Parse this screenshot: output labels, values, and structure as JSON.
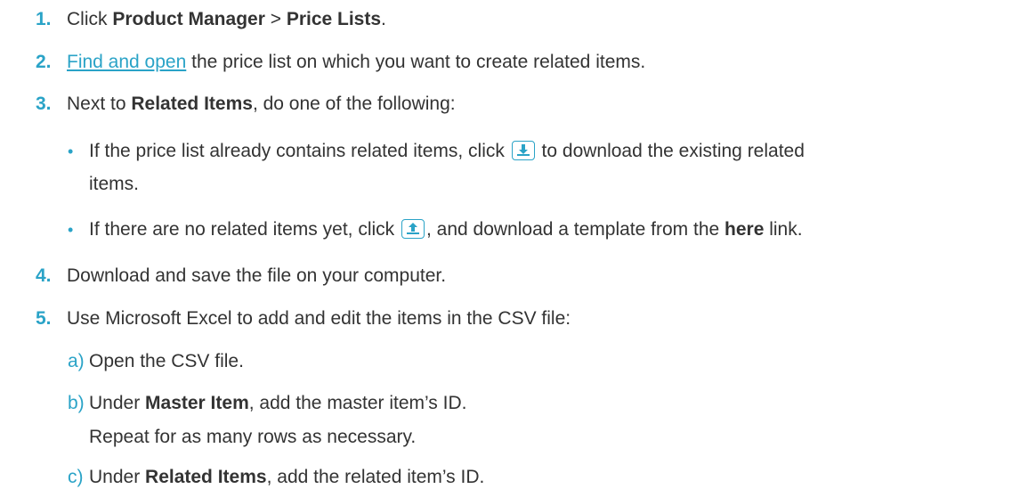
{
  "steps": {
    "s1": {
      "num": "1.",
      "a": "Click ",
      "b1": "Product Manager",
      "c": " > ",
      "b2": "Price Lists",
      "d": "."
    },
    "s2": {
      "num": "2.",
      "link": "Find and open",
      "rest": " the price list on which you want to create related items."
    },
    "s3": {
      "num": "3.",
      "a": "Next to ",
      "b": "Related Items",
      "c": ", do one of the following:"
    },
    "s4": {
      "num": "4.",
      "text": "Download and save the file on your computer."
    },
    "s5": {
      "num": "5.",
      "text": "Use Microsoft Excel to add and edit the items in the CSV file:"
    }
  },
  "bullets": {
    "b1": {
      "a": "If the price list already contains related items, click ",
      "c": " to download the existing related",
      "d": "items."
    },
    "b2": {
      "a": "If there are no related items yet, click ",
      "c": ", and download a template from the ",
      "bold": "here",
      "d": " link."
    }
  },
  "substeps": {
    "a": {
      "label": "a)",
      "text": "Open the CSV file."
    },
    "b": {
      "label": "b)",
      "pre": "Under ",
      "bold": "Master Item",
      "post": ", add the master item’s ID.",
      "note": "Repeat for as many rows as necessary."
    },
    "c": {
      "label": "c)",
      "pre": "Under ",
      "bold": "Related Items",
      "post": ", add the related item’s ID."
    }
  },
  "icons": {
    "download": "download-icon",
    "upload": "upload-icon"
  },
  "colors": {
    "accent": "#2aa3c7",
    "text": "#333333"
  }
}
